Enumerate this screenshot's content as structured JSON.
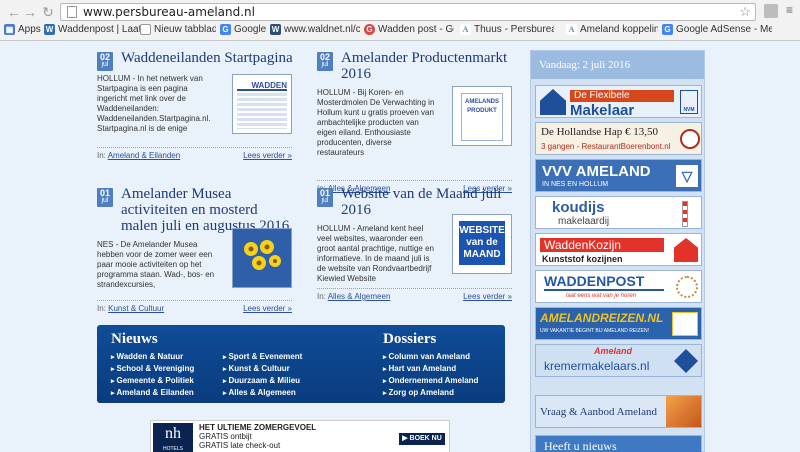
{
  "browser": {
    "url": "www.persbureau-ameland.nl",
    "bookmarks": [
      {
        "label": "Apps",
        "color": "#4a7bd0"
      },
      {
        "label": "Waddenpost | Laat e",
        "color": "#2f6fb5"
      },
      {
        "label": "Nieuw tabblad",
        "color": "#999999"
      },
      {
        "label": "Google",
        "color": "#4285f4"
      },
      {
        "label": "www.waldnet.nl/cocl",
        "color": "#2c4f7a"
      },
      {
        "label": "Wadden post - Goog",
        "color": "#d44"
      },
      {
        "label": "Thuus - Persbureau",
        "color": "#6b87b5"
      },
      {
        "label": "Ameland koppelinge",
        "color": "#6b87b5"
      },
      {
        "label": "Google AdSense - Me",
        "color": "#4285f4"
      }
    ]
  },
  "articles": [
    {
      "day": "02",
      "month": "jul",
      "title": "Waddeneilanden Startpagina",
      "text": "HOLLUM - In het netwerk van Startpagina is een pagina ingericht met link over de Waddeneilanden: Waddeneilanden.Startpagina.nl. Startpagina.nl is de enige",
      "image_label": "WADDEN",
      "category_prefix": "In:",
      "category": "Ameland & Eilanden",
      "more": "Lees verder »"
    },
    {
      "day": "02",
      "month": "jul",
      "title": "Amelander Productenmarkt 2016",
      "text": "HOLLUM - Bij Koren- en Mosterdmolen De Verwachting in Hollum kunt u gratis proeven van ambachtelijke producten van eigen eiland. Enthousiaste producenten, diverse restaurateurs",
      "image_label": "AMELANDS PRODUKT",
      "category_prefix": "In:",
      "category": "Alles & Algemeen",
      "more": "Lees verder »"
    },
    {
      "day": "01",
      "month": "jul",
      "title": "Amelander Musea activiteiten en mosterd malen juli en augustus 2016",
      "text": "NES - De Amelander Musea hebben voor de zomer weer een paar mooie activiteiten op het programma staan. Wad-, bos- en strandexcursies,",
      "image_label": "",
      "category_prefix": "In:",
      "category": "Kunst & Cultuur",
      "more": "Lees verder »"
    },
    {
      "day": "01",
      "month": "jul",
      "title": "Website van de Maand juli 2016",
      "text": "HOLLUM - Ameland kent heel veel websites, waaronder een groot aantal prachtige, nuttige en informatieve. In de maand juli is de website van Rondvaartbedrijf Kiewied Website",
      "image_label": "WEBSITE van de MAAND",
      "category_prefix": "In:",
      "category": "Alles & Algemeen",
      "more": "Lees verder »"
    }
  ],
  "nieuws": {
    "heading": "Nieuws",
    "col1": [
      "Wadden & Natuur",
      "School & Vereniging",
      "Gemeente & Politiek",
      "Ameland & Eilanden"
    ],
    "col2": [
      "Sport & Evenement",
      "Kunst & Cultuur",
      "Duurzaam & Milieu",
      "Alles & Algemeen"
    ]
  },
  "dossiers": {
    "heading": "Dossiers",
    "items": [
      "Column van Ameland",
      "Hart van Ameland",
      "Ondernemend Ameland",
      "Zorg op Ameland"
    ]
  },
  "ad": {
    "logo": "nh",
    "logo_sub": "HOTELS",
    "lines": [
      "HET ULTIEME ZOMERGEVOEL",
      "GRATIS ontbijt",
      "GRATIS late check-out"
    ],
    "button": "▶ BOEK NU"
  },
  "sidebar": {
    "today_label": "Vandaag:",
    "today_date": "2 juli 2016",
    "banners": [
      {
        "title": "De Flexibele",
        "title2": "Makelaar",
        "badge": "NVM",
        "bg": "#e8f0fa",
        "accent": "#d6471c"
      },
      {
        "title": "De Hollandse Hap € 13,50",
        "sub": "3 gangen - RestaurantBoerenbont.nl",
        "bg": "#f7f1e4",
        "accent": "#b52a1e"
      },
      {
        "title": "VVV AMELAND",
        "sub": "IN NES EN HOLLUM",
        "bg": "#3b6fb8",
        "accent": "#ffffff"
      },
      {
        "title": "koudijs",
        "sub": "makelaardij",
        "bg": "#ffffff",
        "accent": "#2d5ca8"
      },
      {
        "title": "WaddenKozijn",
        "sub": "Kunststof kozijnen",
        "bg": "#ffffff",
        "accent": "#e2332b"
      },
      {
        "title": "WADDENPOST",
        "sub": "laat eens wat van je horen",
        "bg": "#ffffff",
        "accent": "#2458a4"
      },
      {
        "title": "AMELANDREIZEN.NL",
        "sub": "UW VAKANTIE BEGINT BIJ AMELAND REIZEN!",
        "bg": "#2a62ad",
        "accent": "#f0c21f"
      },
      {
        "title": "Ameland",
        "sub": "kremermakelaars.nl",
        "bg": "#cfe0f3",
        "accent": "#1f4f9a"
      },
      {
        "title": "Vraag & Aanbod Ameland",
        "bg": "#dbe7f5",
        "accent": "#1f3a7a"
      },
      {
        "title": "Heeft u nieuws",
        "bg": "#3f78c3",
        "accent": "#ffffff"
      }
    ]
  }
}
